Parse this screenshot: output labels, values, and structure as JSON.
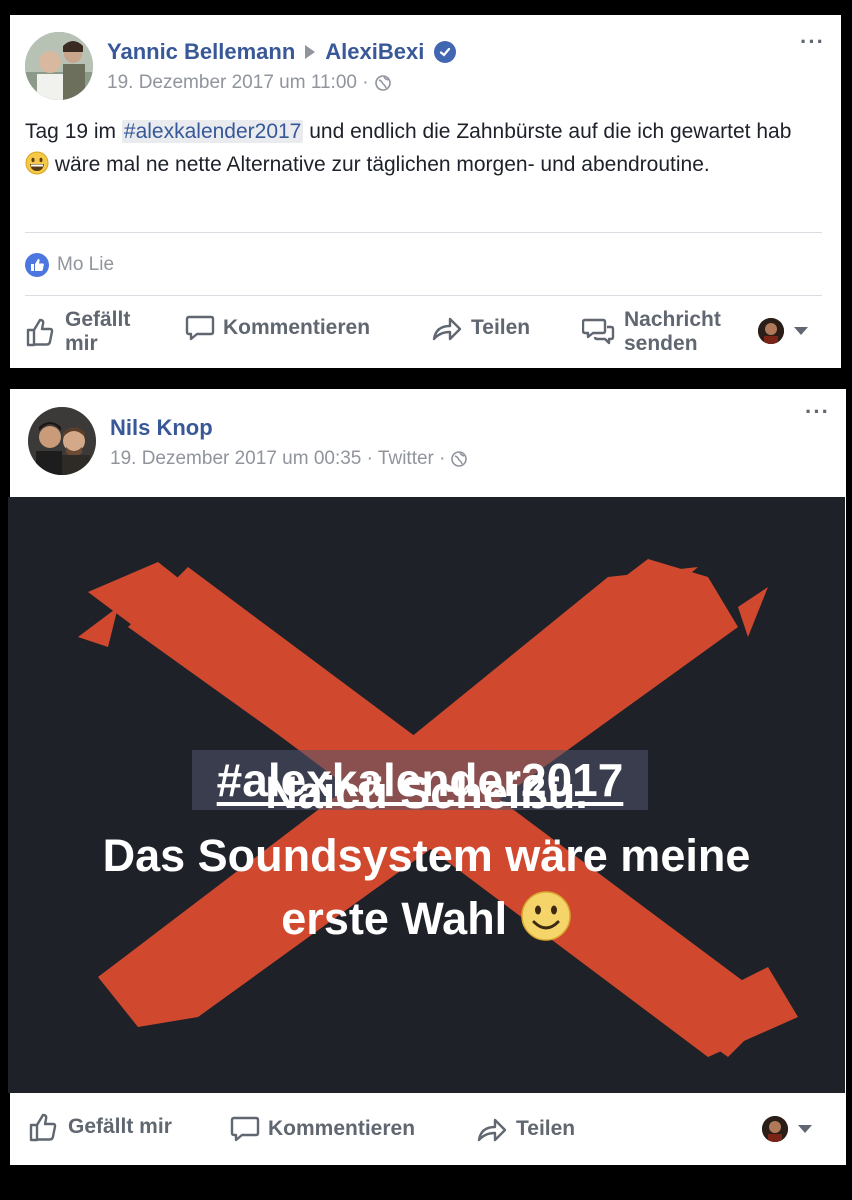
{
  "post1": {
    "author": "Yannic Bellemann",
    "target_page": "AlexiBexi",
    "timestamp": "19. Dezember 2017 um 11:00 ·",
    "text_before": "Tag 19 im ",
    "hashtag": "#alexkalender2017",
    "text_middle": " und endlich die Zahnbürste auf die ich gewartet hab ",
    "emoji": "grinning-face",
    "text_after": " wäre mal ne nette Alternative zur täglichen morgen- und abendroutine.",
    "reaction_name": "Mo Lie",
    "actions": {
      "like": "Gefällt mir",
      "comment": "Kommentieren",
      "share": "Teilen",
      "message": "Nachricht senden"
    }
  },
  "post2": {
    "author": "Nils Knop",
    "timestamp": "19. Dezember 2017 um 00:35 · Twitter ·",
    "image": {
      "background_color": "#1f2128",
      "cross_color": "#d0492e",
      "hashtag": "#alexkalender2017",
      "line1": "Naicü Scheißü.",
      "line2": "Das Soundsystem wäre meine",
      "line3": "erste Wahl",
      "emoji": "smiling-face"
    },
    "actions": {
      "like": "Gefällt mir",
      "comment": "Kommentieren",
      "share": "Teilen"
    }
  },
  "colors": {
    "link": "#385898",
    "meta": "#90949c",
    "action": "#606770",
    "like_blue": "#4c76e0"
  }
}
